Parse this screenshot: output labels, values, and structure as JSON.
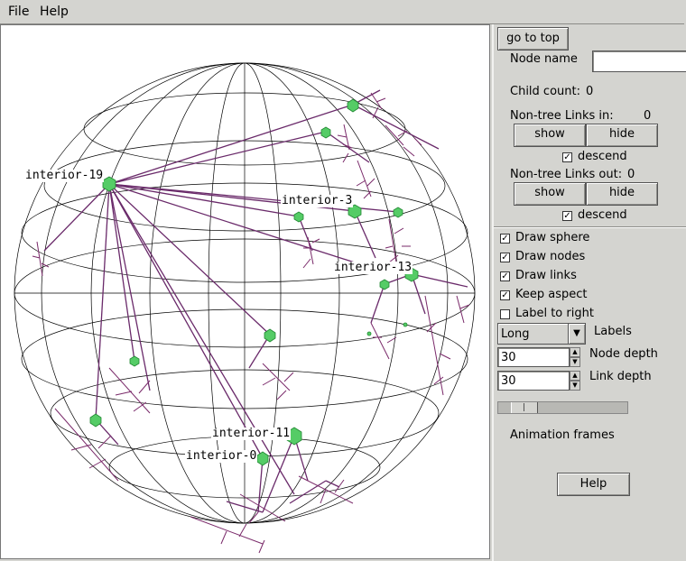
{
  "menubar": {
    "file": "File",
    "help": "Help"
  },
  "canvas": {
    "labels": [
      "interior-19",
      "interior-3",
      "interior-13",
      "interior-11",
      "interior-0"
    ]
  },
  "panel": {
    "go_to_top": "go to top",
    "node_name_label": "Node name",
    "node_name_value": "",
    "child_count_label": "Child count:",
    "child_count_value": "0",
    "links_in_label": "Non-tree Links in:",
    "links_in_value": "0",
    "links_out_label": "Non-tree Links out:",
    "links_out_value": "0",
    "show": "show",
    "hide": "hide",
    "descend": "descend",
    "descend_in_checked": true,
    "descend_out_checked": true,
    "options": [
      {
        "label": "Draw sphere",
        "checked": true
      },
      {
        "label": "Draw nodes",
        "checked": true
      },
      {
        "label": "Draw links",
        "checked": true
      },
      {
        "label": "Keep aspect",
        "checked": true
      },
      {
        "label": "Label to right",
        "checked": false
      }
    ],
    "labels_select": "Long",
    "labels_label": "Labels",
    "node_depth_value": "30",
    "node_depth_label": "Node depth",
    "link_depth_value": "30",
    "link_depth_label": "Link depth",
    "animation_frames_fraction": 0.12,
    "animation_frames_label": "Animation frames",
    "help_button": "Help"
  },
  "colors": {
    "link": "#6a2a6a",
    "node": "#55cc66",
    "sphere": "#000000"
  }
}
